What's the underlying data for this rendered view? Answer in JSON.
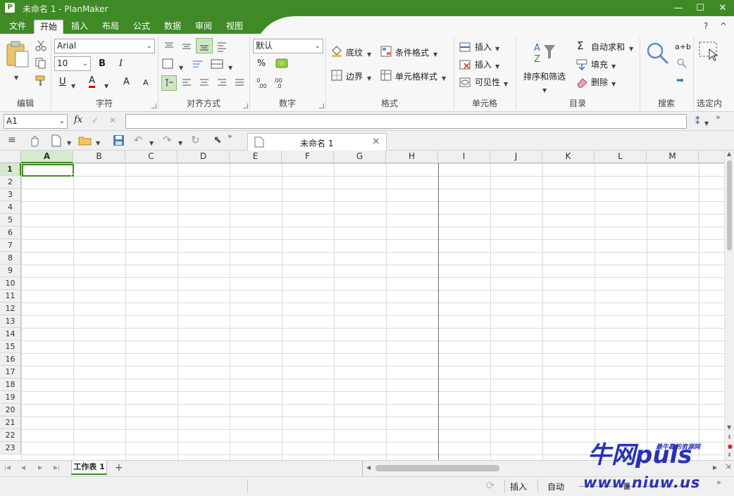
{
  "window": {
    "app_letter": "P",
    "title": "未命名 1 - PlanMaker",
    "help": "?",
    "collapse": "^"
  },
  "menu": {
    "tabs": [
      "文件",
      "开始",
      "插入",
      "布局",
      "公式",
      "数据",
      "审阅",
      "视图"
    ],
    "active": "开始"
  },
  "ribbon": {
    "font_name": "Arial",
    "font_size": "10",
    "number_format": "默认",
    "bold": "B",
    "italic": "I",
    "underline": "U",
    "font_color": "A",
    "grow_font": "A",
    "shrink_font": "A",
    "percent": "%",
    "shading_label": "底纹",
    "border_label": "边界",
    "cond_format_label": "条件格式",
    "cell_style_label": "单元格样式",
    "insert_label_1": "插入",
    "insert_label_2": "插入",
    "visibility_label": "可见性",
    "autosum_label": "自动求和",
    "fill_label": "填充",
    "delete_label": "删除",
    "sort_label": "排序和筛选",
    "replace_label": "a+b",
    "groups": [
      "编辑",
      "字符",
      "对齐方式",
      "数字",
      "格式",
      "单元格",
      "目录",
      "搜索",
      "选定内"
    ]
  },
  "formula_bar": {
    "cell_ref": "A1",
    "fx": "fx",
    "confirm": "✓",
    "cancel": "✕",
    "value": ""
  },
  "document_tab": {
    "name": "未命名 1",
    "close": "×"
  },
  "grid": {
    "columns": [
      "A",
      "B",
      "C",
      "D",
      "E",
      "F",
      "G",
      "H",
      "I",
      "J",
      "K",
      "L",
      "M"
    ],
    "rows": [
      "1",
      "2",
      "3",
      "4",
      "5",
      "6",
      "7",
      "8",
      "9",
      "10",
      "11",
      "12",
      "13",
      "14",
      "15",
      "16",
      "17",
      "18",
      "19",
      "20",
      "21",
      "22",
      "23"
    ],
    "active_cell": "A1"
  },
  "sheets": {
    "tabs": [
      "工作表 1"
    ],
    "add": "+"
  },
  "status": {
    "mode": "插入",
    "calc": "自动",
    "zoom_suffix": "»"
  },
  "watermark": {
    "main": "牛网puls",
    "tagline": "最牛靠的资源网",
    "url": "www.niuw.us"
  },
  "colors": {
    "accent": "#3f8a26",
    "ribbon_bg": "#f7f7f7",
    "watermark": "#2a31b8"
  }
}
